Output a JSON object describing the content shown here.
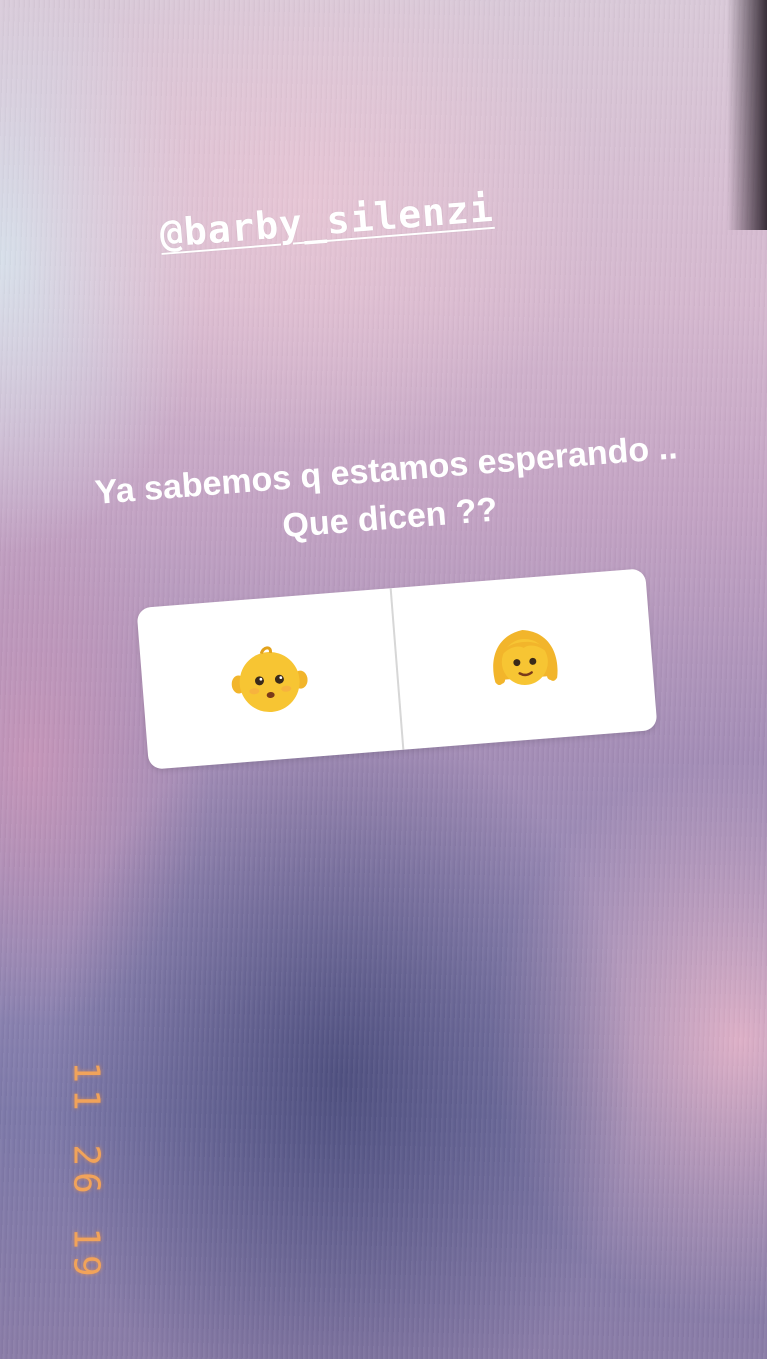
{
  "story": {
    "mention": "@barby_silenzi",
    "question_line1": "Ya sabemos q estamos esperando ..",
    "question_line2": "Que dicen ??",
    "poll": {
      "options": [
        {
          "icon": "baby-emoji-icon"
        },
        {
          "icon": "girl-emoji-icon"
        }
      ]
    },
    "date_stamp": "11 26 19"
  },
  "colors": {
    "date_stamp": "#f1a35a",
    "emoji_yellow": "#f7c533"
  }
}
